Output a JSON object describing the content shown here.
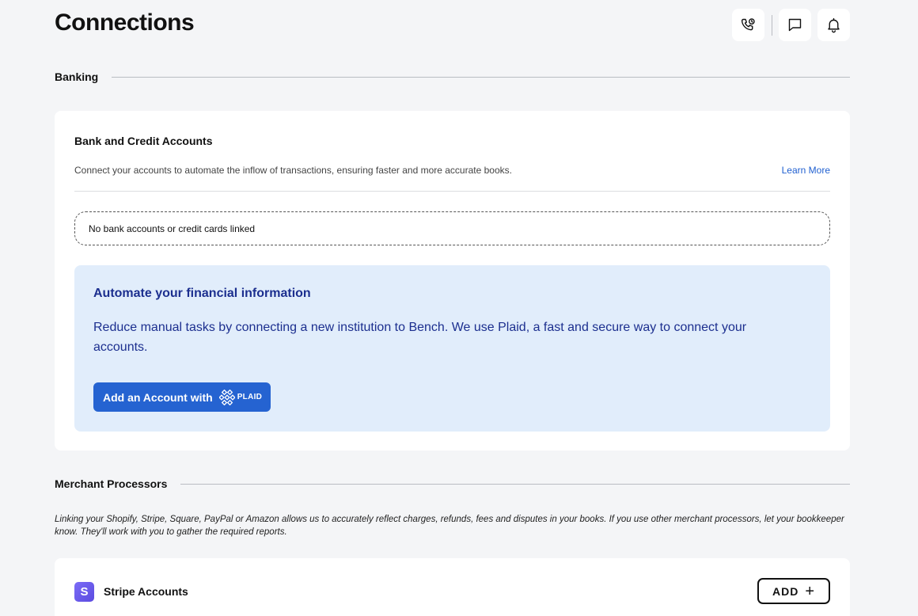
{
  "header": {
    "title": "Connections",
    "icons": [
      "phone-icon",
      "chat-icon",
      "bell-icon"
    ]
  },
  "banking": {
    "section_label": "Banking",
    "card": {
      "title": "Bank and Credit Accounts",
      "description": "Connect your accounts to automate the inflow of transactions, ensuring faster and more accurate books.",
      "learn_more": "Learn More",
      "empty_state": "No bank accounts or credit cards linked",
      "promo": {
        "title": "Automate your financial information",
        "body": "Reduce manual tasks by connecting a new institution to Bench. We use Plaid, a fast and secure way to connect your accounts.",
        "button_label": "Add an Account with",
        "button_brand": "PLAID"
      }
    }
  },
  "merchant": {
    "section_label": "Merchant Processors",
    "description": "Linking your Shopify, Stripe, Square, PayPal or Amazon allows us to accurately reflect charges, refunds, fees and disputes in your books. If you use other merchant processors, let your bookkeeper know. They'll work with you to gather the required reports.",
    "stripe": {
      "logo_letter": "S",
      "title": "Stripe Accounts",
      "add_label": "ADD",
      "add_symbol": "+"
    }
  },
  "colors": {
    "accent": "#2563d1",
    "promo_bg": "#e1edfb",
    "promo_text": "#1c2f8f",
    "link": "#1f5fd0",
    "page_bg": "#f4f5f7"
  }
}
